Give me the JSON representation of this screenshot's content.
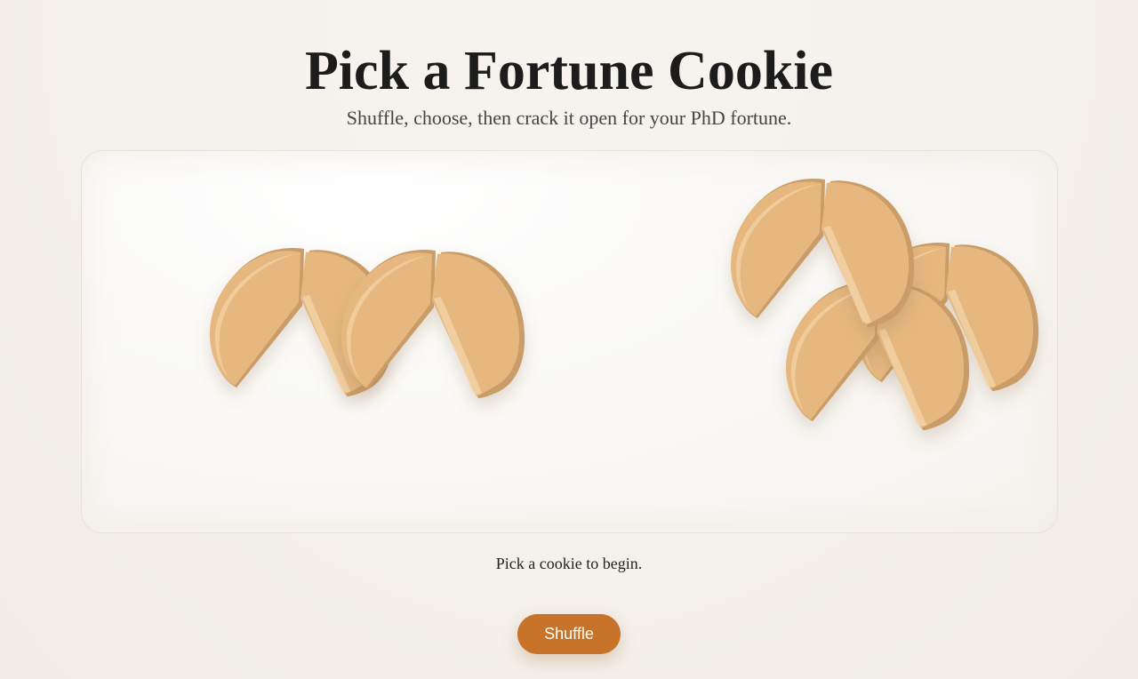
{
  "header": {
    "title": "Pick a Fortune Cookie",
    "subtitle": "Shuffle, choose, then crack it open for your PhD fortune."
  },
  "game": {
    "cookie_count": 5,
    "status_text": "Pick a cookie to begin."
  },
  "controls": {
    "shuffle_label": "Shuffle"
  },
  "colors": {
    "cookie_face": "#e6b880",
    "cookie_edge": "#c99c68",
    "cookie_highlight": "#f3d3a6",
    "button": "#c8732a",
    "background": "#f4f0ea"
  }
}
